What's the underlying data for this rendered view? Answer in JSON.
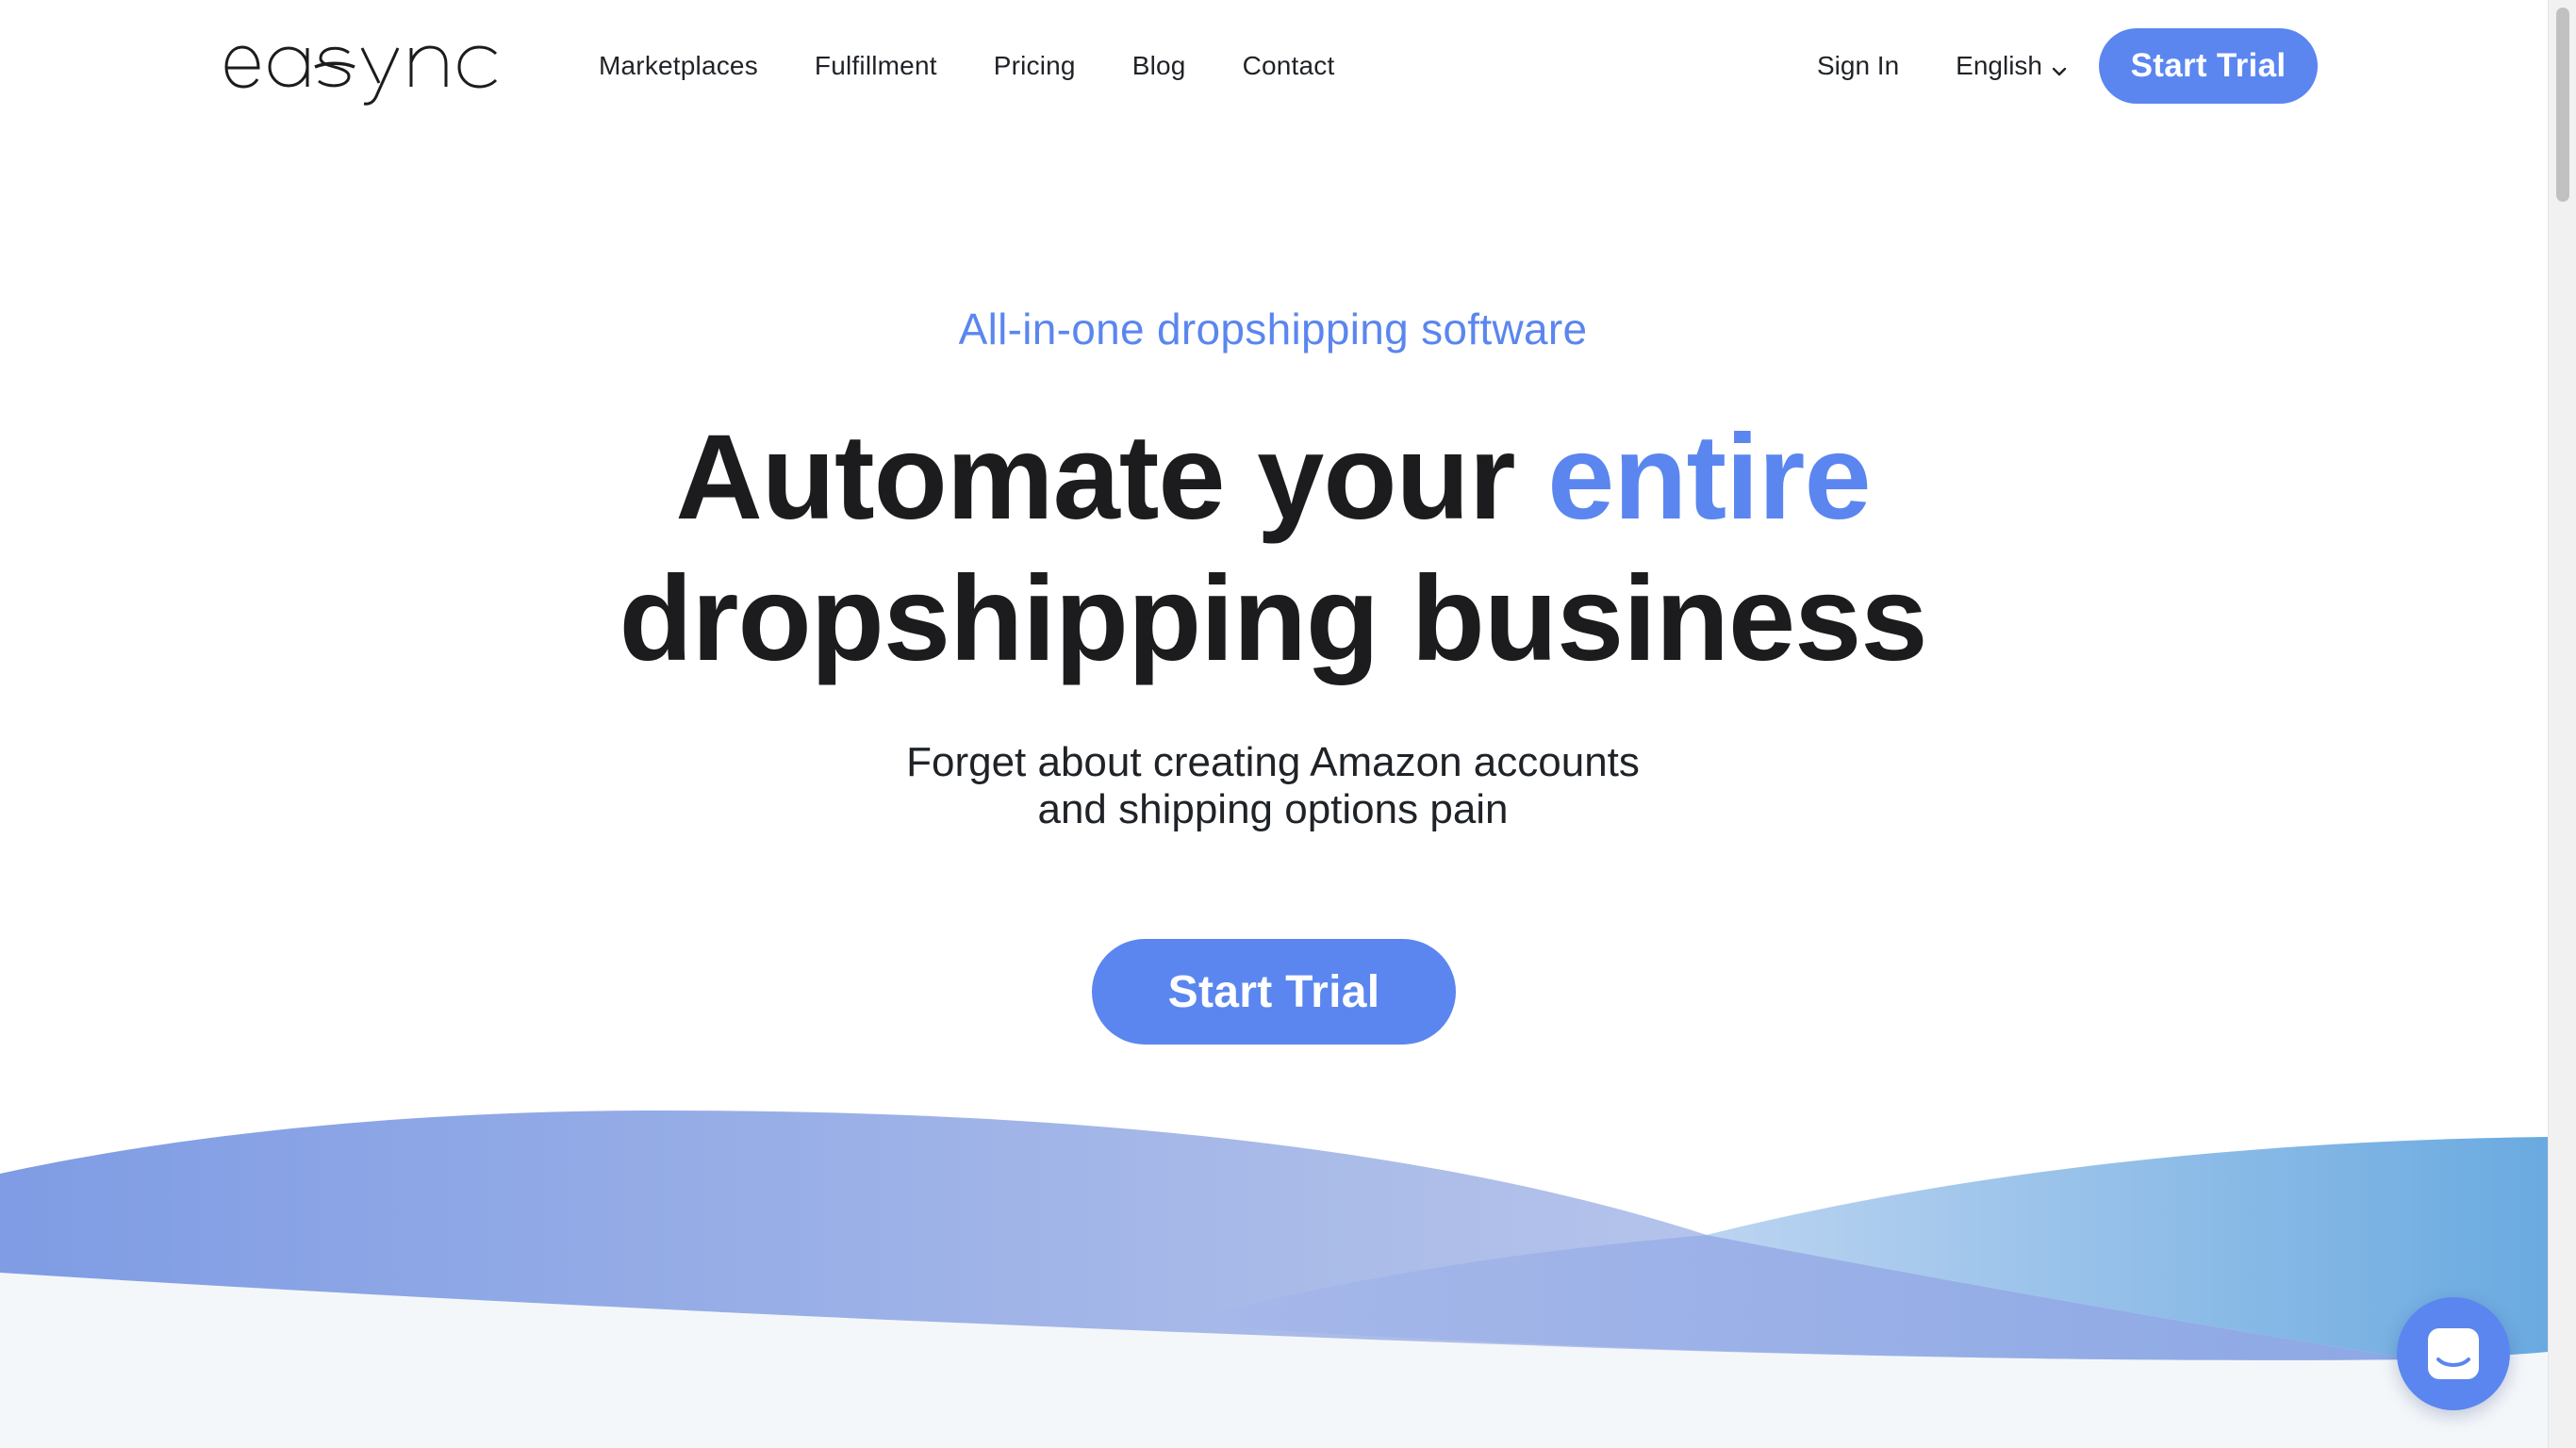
{
  "brand": {
    "logo_text": "easync",
    "accent_color": "#5b86ef"
  },
  "nav": {
    "items": [
      {
        "label": "Marketplaces"
      },
      {
        "label": "Fulfillment"
      },
      {
        "label": "Pricing"
      },
      {
        "label": "Blog"
      },
      {
        "label": "Contact"
      }
    ]
  },
  "header": {
    "sign_in_label": "Sign In",
    "language_label": "English",
    "cta_label": "Start Trial"
  },
  "hero": {
    "eyebrow": "All-in-one dropshipping software",
    "headline_part1": "Automate your",
    "headline_accent": "entire",
    "headline_line2": "dropshipping business",
    "subheadline_line1": "Forget about creating Amazon accounts",
    "subheadline_line2": "and shipping options pain",
    "cta_label": "Start Trial"
  },
  "widgets": {
    "chat_icon": "chat-bubble-icon",
    "language_icon": "chevron-down-icon"
  }
}
